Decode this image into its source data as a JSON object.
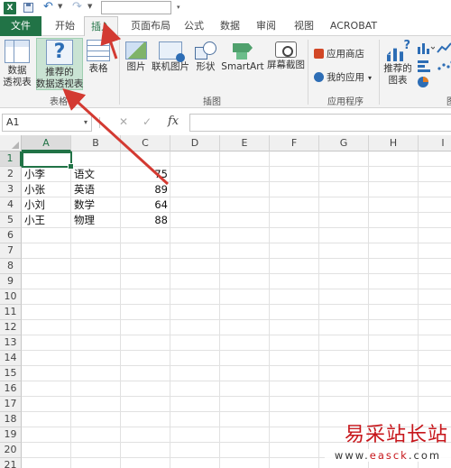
{
  "tabs": {
    "file": "文件",
    "home": "开始",
    "insert": "插入",
    "page_layout": "页面布局",
    "formulas": "公式",
    "data": "数据",
    "review": "审阅",
    "view": "视图",
    "acrobat": "ACROBAT"
  },
  "ribbon": {
    "pivot_line1": "数据",
    "pivot_line2": "透视表",
    "recommended_pivot_line1": "推荐的",
    "recommended_pivot_line2": "数据透视表",
    "table": "表格",
    "group_tables": "表格",
    "picture": "图片",
    "online_picture": "联机图片",
    "shapes": "形状",
    "smartart": "SmartArt",
    "screenshot": "屏幕截图",
    "group_illustrations": "插图",
    "app_store": "应用商店",
    "my_apps": "我的应用",
    "group_apps": "应用程序",
    "recommended_charts_line1": "推荐的",
    "recommended_charts_line2": "图表",
    "group_charts_partial": "图"
  },
  "formula_bar": {
    "name_box": "A1",
    "cancel": "✕",
    "enter": "✓",
    "fx": "fx",
    "content": ""
  },
  "sheet": {
    "active_cell": "A1",
    "columns": [
      "A",
      "B",
      "C",
      "D",
      "E",
      "F",
      "G",
      "H",
      "I"
    ],
    "rows": [
      "1",
      "2",
      "3",
      "4",
      "5",
      "6",
      "7",
      "8",
      "9",
      "10",
      "11",
      "12",
      "13",
      "14",
      "15",
      "16",
      "17",
      "18",
      "19",
      "20",
      "21"
    ],
    "data": [
      {
        "name": "小李",
        "subject": "语文",
        "score": "75"
      },
      {
        "name": "小张",
        "subject": "英语",
        "score": "89"
      },
      {
        "name": "小刘",
        "subject": "数学",
        "score": "64"
      },
      {
        "name": "小王",
        "subject": "物理",
        "score": "88"
      }
    ]
  },
  "watermark": {
    "title": "易采站长站",
    "url_prefix": "www.",
    "url_brand": "easck",
    "url_suffix": ".com"
  },
  "colors": {
    "excel_green": "#217346",
    "annotation_red": "#d33a32"
  }
}
